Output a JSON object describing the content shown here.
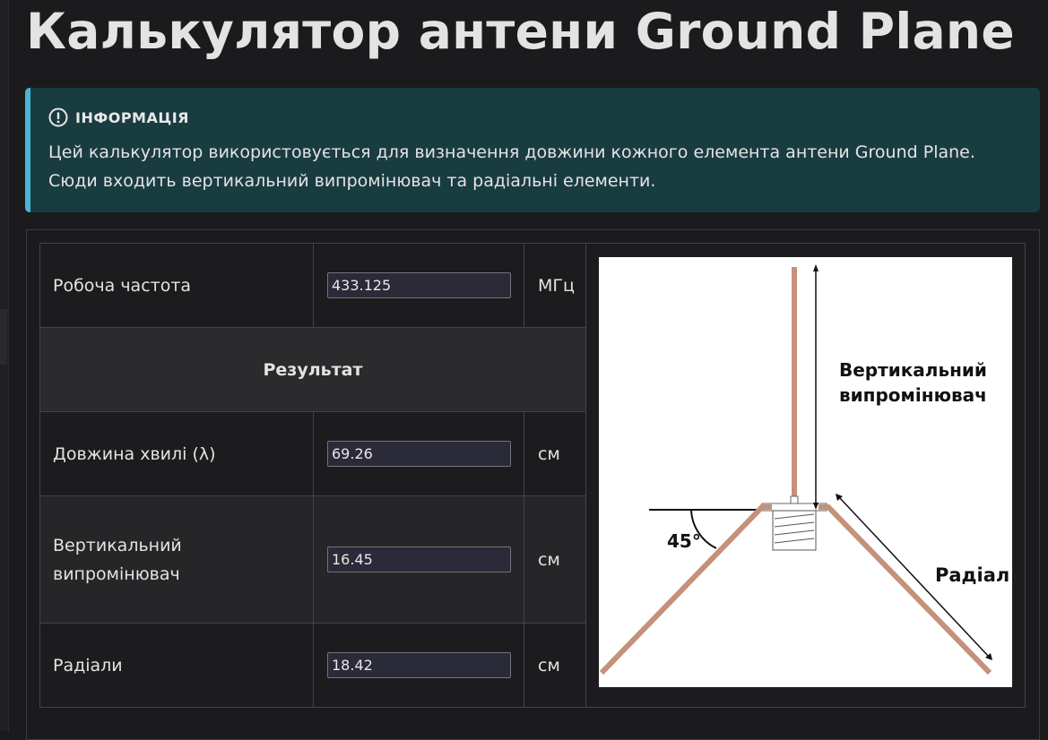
{
  "page": {
    "title": "Калькулятор антени Ground Plane"
  },
  "info": {
    "title": "ІНФОРМАЦІЯ",
    "text": "Цей калькулятор використовується для визначення довжини кожного елемента антени Ground Plane. Сюди входить вертикальний випромінювач та радіальні елементи.",
    "icon": "exclamation-circle-icon",
    "accent_color": "#4cb3d4",
    "background_color": "#193c40"
  },
  "calculator": {
    "frequency": {
      "label": "Робоча частота",
      "value": "433.125",
      "unit": "МГц"
    },
    "result_header": "Результат",
    "wavelength": {
      "label": "Довжина хвилі (λ)",
      "value": "69.26",
      "unit": "см"
    },
    "vertical": {
      "label": "Вертикальний випромінювач",
      "value": "16.45",
      "unit": "см"
    },
    "radials": {
      "label": "Радіали",
      "value": "18.42",
      "unit": "см"
    }
  },
  "diagram": {
    "vertical_label_line1": "Вертикальний",
    "vertical_label_line2": "випромінювач",
    "radial_label": "Радіал",
    "angle_label": "45°",
    "element_color": "#c4917a"
  }
}
